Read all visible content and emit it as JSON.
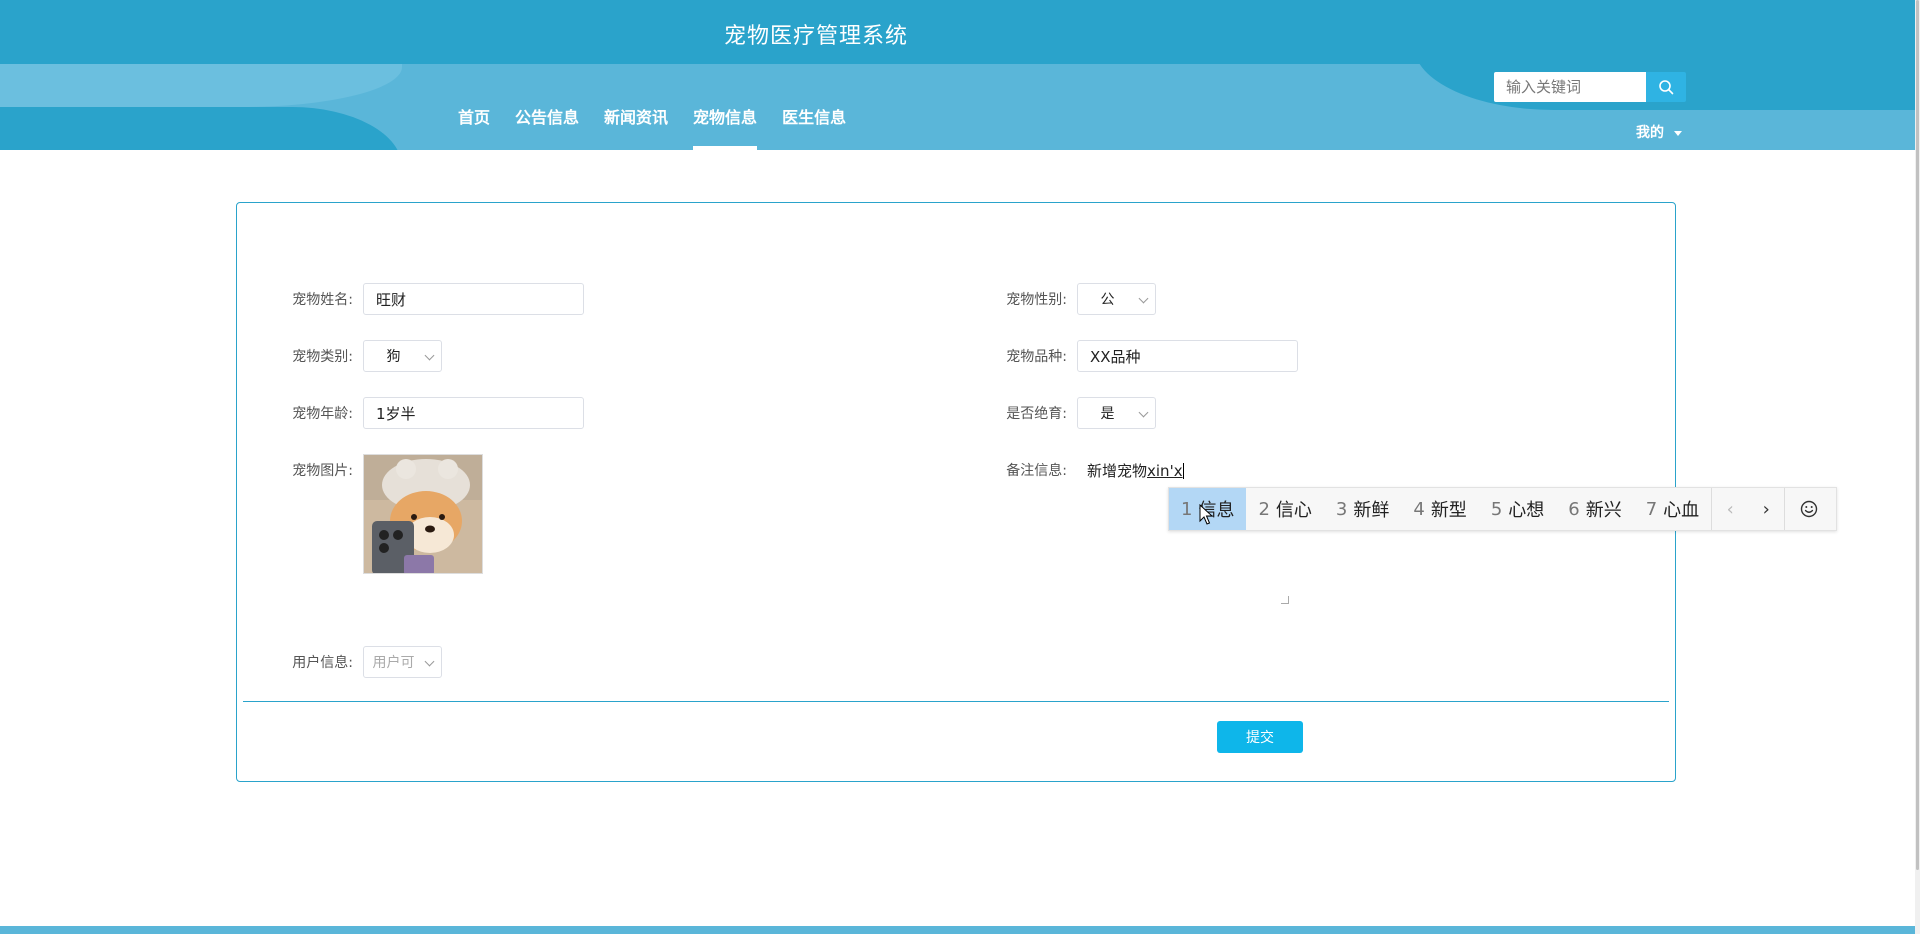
{
  "header": {
    "title": "宠物医疗管理系统",
    "nav": [
      {
        "label": "首页",
        "active": false
      },
      {
        "label": "公告信息",
        "active": false
      },
      {
        "label": "新闻资讯",
        "active": false
      },
      {
        "label": "宠物信息",
        "active": true
      },
      {
        "label": "医生信息",
        "active": false
      }
    ],
    "search": {
      "placeholder": "输入关键词",
      "icon": "search-icon"
    },
    "user_menu": {
      "label": "我的",
      "icon": "caret-down-icon"
    }
  },
  "form": {
    "pet_name": {
      "label": "宠物姓名:",
      "value": "旺财"
    },
    "pet_gender": {
      "label": "宠物性别:",
      "value": "公"
    },
    "pet_type": {
      "label": "宠物类别:",
      "value": "狗"
    },
    "pet_breed": {
      "label": "宠物品种:",
      "value": "XX品种"
    },
    "pet_age": {
      "label": "宠物年龄:",
      "value": "1岁半"
    },
    "neutered": {
      "label": "是否绝育:",
      "value": "是"
    },
    "pet_photo": {
      "label": "宠物图片:"
    },
    "remarks": {
      "label": "备注信息:",
      "committed_text": "新增宠物",
      "pinyin_text": "xin'x"
    },
    "user_info": {
      "label": "用户信息:",
      "value": "用户可"
    },
    "submit_label": "提交"
  },
  "ime": {
    "candidates": [
      {
        "num": "1",
        "text": "信息",
        "selected": true
      },
      {
        "num": "2",
        "text": "信心",
        "selected": false
      },
      {
        "num": "3",
        "text": "新鲜",
        "selected": false
      },
      {
        "num": "4",
        "text": "新型",
        "selected": false
      },
      {
        "num": "5",
        "text": "心想",
        "selected": false
      },
      {
        "num": "6",
        "text": "新兴",
        "selected": false
      },
      {
        "num": "7",
        "text": "心血",
        "selected": false
      }
    ],
    "prev_glyph": "‹",
    "next_glyph": "›",
    "emoji_icon": "smiley-icon"
  },
  "colors": {
    "header_dark": "#2aa3cb",
    "header_light": "#5ab6d9",
    "accent": "#0eb6ea",
    "ime_selected": "#b3d7f5"
  }
}
